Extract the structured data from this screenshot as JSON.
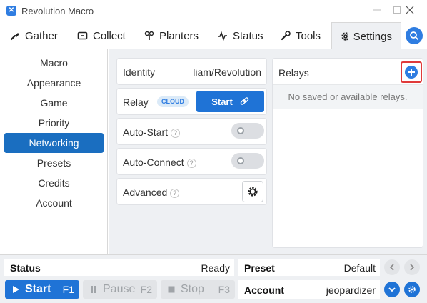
{
  "window": {
    "title": "Revolution Macro"
  },
  "tabs": [
    {
      "label": "Gather",
      "icon": "gather-icon"
    },
    {
      "label": "Collect",
      "icon": "collect-icon"
    },
    {
      "label": "Planters",
      "icon": "planters-icon"
    },
    {
      "label": "Status",
      "icon": "status-pulse-icon"
    },
    {
      "label": "Tools",
      "icon": "wrench-icon"
    },
    {
      "label": "Settings",
      "icon": "gear-icon",
      "active": true
    }
  ],
  "sidebar": {
    "items": [
      {
        "label": "Macro"
      },
      {
        "label": "Appearance"
      },
      {
        "label": "Game"
      },
      {
        "label": "Priority"
      },
      {
        "label": "Networking",
        "active": true
      },
      {
        "label": "Presets"
      },
      {
        "label": "Credits"
      },
      {
        "label": "Account"
      }
    ]
  },
  "networking": {
    "identity_label": "Identity",
    "identity_value": "liam/Revolution",
    "relay_label": "Relay",
    "relay_badge": "CLOUD",
    "relay_start_label": "Start",
    "autostart_label": "Auto-Start",
    "autostart_enabled": false,
    "autoconnect_label": "Auto-Connect",
    "autoconnect_enabled": false,
    "advanced_label": "Advanced",
    "help_glyph": "?"
  },
  "relays": {
    "title": "Relays",
    "empty_text": "No saved or available relays."
  },
  "statusbar": {
    "status_label": "Status",
    "status_value": "Ready",
    "preset_label": "Preset",
    "preset_value": "Default",
    "account_label": "Account",
    "account_value": "jeopardizer",
    "start_label": "Start",
    "start_key": "F1",
    "pause_label": "Pause",
    "pause_key": "F2",
    "stop_label": "Stop",
    "stop_key": "F3"
  },
  "colors": {
    "accent": "#2f7de1",
    "sidebar_active": "#1a6ec0",
    "highlight_outline": "#e03a3a",
    "panel_bg": "#eef0f3"
  }
}
